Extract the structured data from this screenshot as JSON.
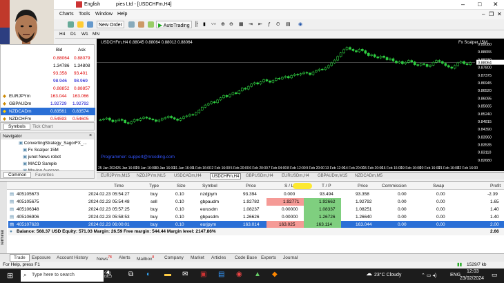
{
  "app": {
    "title": "pies Ltd - [USDCHFm,H4]",
    "language": "English"
  },
  "menu": [
    "Charts",
    "Tools",
    "Window",
    "Help"
  ],
  "toolbar": {
    "new_order": "New Order",
    "autotrading": "AutoTrading",
    "timeframes": [
      "H4",
      "D1",
      "W1",
      "MN"
    ]
  },
  "market_watch": {
    "headers": {
      "bid": "Bid",
      "ask": "Ask"
    },
    "top_rows": [
      {
        "bid": "0.88064",
        "ask": "0.88079"
      },
      {
        "bid": "1.34786",
        "ask": "1.34808"
      },
      {
        "bid": "93.358",
        "ask": "93.401"
      },
      {
        "bid": "98.946",
        "ask": "98.969"
      },
      {
        "bid": "0.88852",
        "ask": "0.88857"
      }
    ],
    "rows": [
      {
        "symbol": "EURJPYm",
        "bid": "163.044",
        "ask": "163.066"
      },
      {
        "symbol": "GBPAUDm",
        "bid": "1.92729",
        "ask": "1.92792"
      },
      {
        "symbol": "NZDCADm",
        "bid": "0.83561",
        "ask": "0.83574"
      },
      {
        "symbol": "NZDCHFm",
        "bid": "0.54593",
        "ask": "0.54605"
      }
    ],
    "tabs": [
      "Symbols",
      "Tick Chart"
    ]
  },
  "navigator": {
    "title": "Navigator",
    "items": [
      "ConvertingStrategy_SagorFX_...",
      "Fx Scalper 15M",
      "junet News robot",
      "MACD Sample",
      "Moving Average"
    ],
    "tabs": [
      "Common",
      "Favorites"
    ]
  },
  "chart": {
    "header": "USDCHFm,H4  0.88045 0.88064 0.88012 0.88064",
    "ea_label": "Fx Scalper 15M",
    "watermark": "Programmer: support@nrcoding.com",
    "price_labels": [
      "0.89080",
      "0.88655",
      "0.88230",
      "0.87800",
      "0.87375",
      "0.86945",
      "0.86520",
      "0.86095",
      "0.85665",
      "0.85240",
      "0.84815",
      "0.84390",
      "0.83960",
      "0.83535",
      "0.83110",
      "0.82680"
    ],
    "current_price": "0.88064",
    "date_labels": [
      "25 Jan 2024",
      "26 Jan 16:00",
      "29 Jan 16:00",
      "30 Jan 16:00",
      "31 Jan 16:00",
      "1 Feb 16:00",
      "2 Feb 16:00",
      "5 Feb 20:00",
      "6 Feb 20:00",
      "7 Feb 04:00",
      "8 Feb 12:00",
      "9 Feb 20:00",
      "13 Feb 12:00",
      "14 Feb 20:00",
      "15 Feb 20:00",
      "16 Feb 16:00",
      "19 Feb 16:00",
      "20 Feb 16:00",
      "21 Feb 16:00",
      "22 Feb 16:00"
    ],
    "candles": [
      0.849,
      0.8495,
      0.85,
      0.8489,
      0.848,
      0.8486,
      0.8493,
      0.8488,
      0.8475,
      0.847,
      0.848,
      0.8492,
      0.8488,
      0.8498,
      0.8505,
      0.85,
      0.8495,
      0.849,
      0.8482,
      0.8489,
      0.8497,
      0.8503,
      0.851,
      0.8502,
      0.8495,
      0.8488,
      0.8498,
      0.8508,
      0.8512,
      0.852,
      0.8518,
      0.853,
      0.8545,
      0.856,
      0.8572,
      0.858,
      0.859,
      0.8585,
      0.86,
      0.8612,
      0.8625,
      0.8618,
      0.863,
      0.864,
      0.8635,
      0.865,
      0.8665,
      0.866,
      0.8675,
      0.8688,
      0.8695,
      0.8688,
      0.87,
      0.8712,
      0.8705,
      0.8698,
      0.8708,
      0.872,
      0.8716,
      0.8725,
      0.873,
      0.8722,
      0.8735,
      0.8742,
      0.8738,
      0.8745,
      0.8752,
      0.8748,
      0.874,
      0.8755,
      0.8762,
      0.877,
      0.8768,
      0.8778,
      0.879,
      0.8805,
      0.882,
      0.884,
      0.886,
      0.8878,
      0.889,
      0.888,
      0.8872,
      0.8866,
      0.888,
      0.8872,
      0.8858,
      0.8845,
      0.885,
      0.8838,
      0.8832,
      0.8842,
      0.8835,
      0.8822,
      0.8828,
      0.8815,
      0.8805,
      0.8812,
      0.88,
      0.8808,
      0.8818,
      0.881,
      0.8795,
      0.879,
      0.88,
      0.8796,
      0.8785,
      0.8792,
      0.8808,
      0.8818,
      0.8812,
      0.8802,
      0.879,
      0.8782,
      0.8775,
      0.879,
      0.8805,
      0.8812,
      0.88,
      0.8795,
      0.8806
    ]
  },
  "chart_tabs": [
    "EURJPYm,M15",
    "NZDJPYm,M15",
    "USDCADm,H4",
    "USDCHFm,H4",
    "GBPUSDm,H4",
    "EURUSDm,H4",
    "GBPAUDm,M15",
    "NZDCADm,M5"
  ],
  "terminal": {
    "headers": [
      "Time",
      "Type",
      "Size",
      "Symbol",
      "Price",
      "S / L",
      "T / P",
      "Price",
      "Commission",
      "Swap",
      "Profit"
    ],
    "rows": [
      {
        "order": "405105673",
        "time": "2024.02.23 05:54:27",
        "type": "buy",
        "size": "0.10",
        "symbol": "nzdjpym",
        "price": "93.394",
        "sl": "0.000",
        "tp": "93.494",
        "cur": "93.358",
        "commission": "0.00",
        "swap": "0.00",
        "profit": "-2.39"
      },
      {
        "order": "405105675",
        "time": "2024.02.23 05:54:48",
        "type": "sell",
        "size": "0.10",
        "symbol": "gbpaudm",
        "price": "1.92782",
        "sl": "1.92771",
        "tp": "1.92662",
        "cur": "1.92792",
        "commission": "0.00",
        "swap": "0.00",
        "profit": "1.65"
      },
      {
        "order": "405106348",
        "time": "2024.02.23 05:57:25",
        "type": "buy",
        "size": "0.10",
        "symbol": "eurusdm",
        "price": "1.08237",
        "sl": "0.00000",
        "tp": "1.08337",
        "cur": "1.08251",
        "commission": "0.00",
        "swap": "0.00",
        "profit": "1.40"
      },
      {
        "order": "405106906",
        "time": "2024.02.23 05:58:53",
        "type": "buy",
        "size": "0.10",
        "symbol": "gbpusdm",
        "price": "1.26626",
        "sl": "0.00000",
        "tp": "1.26726",
        "cur": "1.26640",
        "commission": "0.00",
        "swap": "0.00",
        "profit": "1.40"
      },
      {
        "order": "405107628",
        "time": "2024.02.23 06:00:01",
        "type": "buy",
        "size": "0.10",
        "symbol": "eurjpym",
        "price": "163.014",
        "sl": "163.025",
        "tp": "163.114",
        "cur": "163.044",
        "commission": "0.00",
        "swap": "0.00",
        "profit": "2.00"
      }
    ],
    "balance_line": "Balance: 568.37 USD  Equity: 571.03  Margin: 26.59  Free margin: 544.44  Margin level: 2147.86%",
    "total_profit": "2.66",
    "tabs": [
      "Trade",
      "Exposure",
      "Account History",
      "News",
      "Alerts",
      "Mailbox",
      "Company",
      "Market",
      "Articles",
      "Code Base",
      "Experts",
      "Journal"
    ],
    "news_count": "78",
    "mailbox_count": "8",
    "side_label": "Terminal"
  },
  "status": {
    "help": "For Help, press F1",
    "traffic": "1529/7 kb"
  },
  "taskbar": {
    "search": "Type here to search",
    "weather": "23°C  Cloudy",
    "lang": "ENG",
    "time": "12:03",
    "date": "23/02/2024"
  },
  "colors": {
    "sl_bg": "#f59a96",
    "tp_bg": "#7fcf7f",
    "selected": "#2a6fd6",
    "candle": "#2ecc40"
  }
}
